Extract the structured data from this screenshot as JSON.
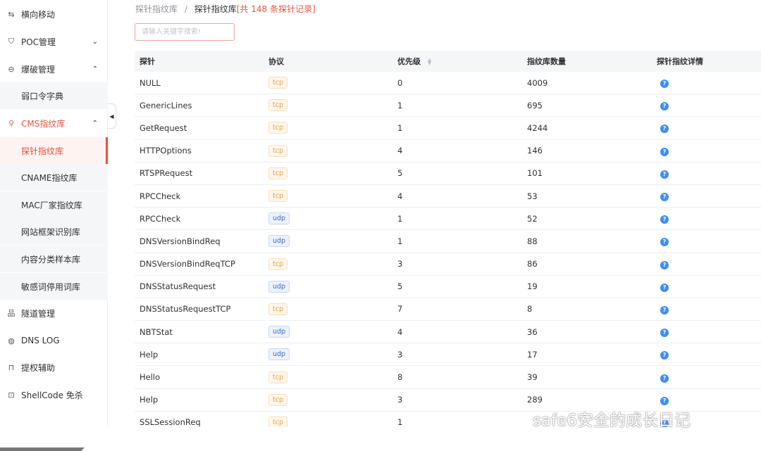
{
  "sidebar": {
    "items": [
      {
        "icon": "swap-icon",
        "glyph": "⇆",
        "label": "横向移动"
      },
      {
        "icon": "shield-icon",
        "glyph": "⛉",
        "label": "POC管理"
      },
      {
        "icon": "exit-icon",
        "glyph": "⊖",
        "label": "爆破管理"
      },
      {
        "label": "弱口令字典"
      },
      {
        "icon": "search-icon",
        "glyph": "⚲",
        "label": "CMS指纹库"
      },
      {
        "label": "探针指纹库"
      },
      {
        "label": "CNAME指纹库"
      },
      {
        "label": "MAC厂家指纹库"
      },
      {
        "label": "网站框架识别库"
      },
      {
        "label": "内容分类样本库"
      },
      {
        "label": "敏感词停用词库"
      },
      {
        "icon": "network-icon",
        "glyph": "品",
        "label": "隧道管理"
      },
      {
        "icon": "globe-icon",
        "glyph": "◍",
        "label": "DNS LOG"
      },
      {
        "icon": "lock-icon",
        "glyph": "⊓",
        "label": "提权辅助"
      },
      {
        "icon": "terminal-icon",
        "glyph": "⊡",
        "label": "ShellCode 免杀"
      }
    ],
    "chevron_down": "⌄",
    "chevron_up": "⌃"
  },
  "breadcrumb": {
    "parent": "探针指纹库",
    "separator": "/",
    "current": "探针指纹库",
    "count": "[共 148 条探针记录]"
  },
  "search": {
    "placeholder": "请输入关键字搜索!"
  },
  "table": {
    "headers": [
      "探针",
      "协议",
      "优先级",
      "指纹库数量",
      "探针指纹详情"
    ],
    "rows": [
      {
        "probe": "NULL",
        "protocol": "tcp",
        "priority": "0",
        "count": "4009"
      },
      {
        "probe": "GenericLines",
        "protocol": "tcp",
        "priority": "1",
        "count": "695"
      },
      {
        "probe": "GetRequest",
        "protocol": "tcp",
        "priority": "1",
        "count": "4244"
      },
      {
        "probe": "HTTPOptions",
        "protocol": "tcp",
        "priority": "4",
        "count": "146"
      },
      {
        "probe": "RTSPRequest",
        "protocol": "tcp",
        "priority": "5",
        "count": "101"
      },
      {
        "probe": "RPCCheck",
        "protocol": "tcp",
        "priority": "4",
        "count": "53"
      },
      {
        "probe": "RPCCheck",
        "protocol": "udp",
        "priority": "1",
        "count": "52"
      },
      {
        "probe": "DNSVersionBindReq",
        "protocol": "udp",
        "priority": "1",
        "count": "88"
      },
      {
        "probe": "DNSVersionBindReqTCP",
        "protocol": "tcp",
        "priority": "3",
        "count": "86"
      },
      {
        "probe": "DNSStatusRequest",
        "protocol": "udp",
        "priority": "5",
        "count": "19"
      },
      {
        "probe": "DNSStatusRequestTCP",
        "protocol": "tcp",
        "priority": "7",
        "count": "8"
      },
      {
        "probe": "NBTStat",
        "protocol": "udp",
        "priority": "4",
        "count": "36"
      },
      {
        "probe": "Help",
        "protocol": "udp",
        "priority": "3",
        "count": "17"
      },
      {
        "probe": "Hello",
        "protocol": "tcp",
        "priority": "8",
        "count": "39"
      },
      {
        "probe": "Help",
        "protocol": "tcp",
        "priority": "3",
        "count": "289"
      },
      {
        "probe": "SSLSessionReq",
        "protocol": "tcp",
        "priority": "1",
        "count": ""
      }
    ]
  },
  "watermark": "safe6安全的成长日记",
  "colors": {
    "accent": "#e8533f",
    "tcp": "#e6a23c",
    "udp": "#3a67c4",
    "info": "#3e8ef7"
  }
}
